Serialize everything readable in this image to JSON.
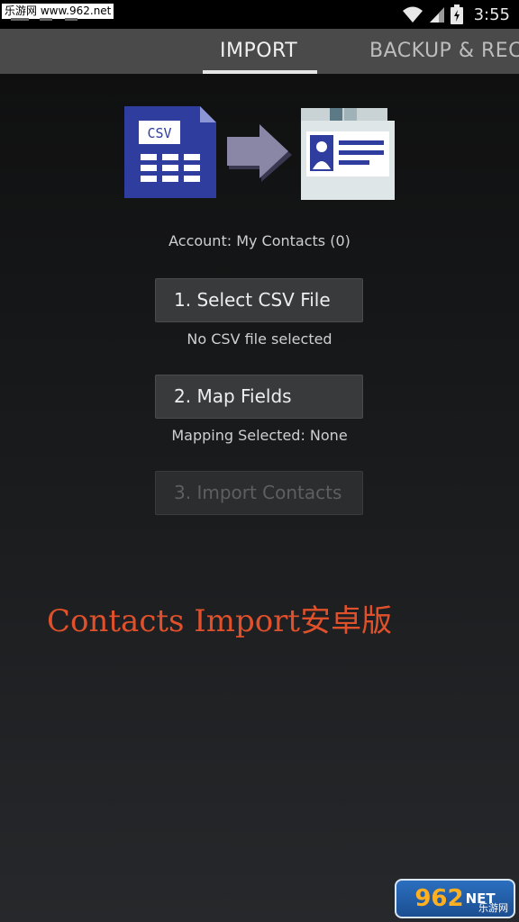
{
  "status_bar": {
    "watermark": "乐游网 www.962.net",
    "time": "3:55",
    "icons": [
      "wifi-icon",
      "signal-icon",
      "battery-icon"
    ]
  },
  "tabs": [
    {
      "label": "IMPORT",
      "active": true
    },
    {
      "label": "BACKUP & RECO",
      "active": false
    }
  ],
  "hero": {
    "file_label": "CSV",
    "icons": [
      "csv-file-icon",
      "arrow-right-icon",
      "contact-card-icon"
    ]
  },
  "account_text": "Account: My Contacts (0)",
  "steps": [
    {
      "button_label": "1. Select CSV File",
      "status": "No CSV file selected",
      "enabled": true
    },
    {
      "button_label": "2. Map Fields",
      "status": "Mapping Selected: None",
      "enabled": true
    },
    {
      "button_label": "3. Import Contacts",
      "enabled": false
    }
  ],
  "overlay_title": "Contacts Import安卓版",
  "corner_badge": {
    "number": "962",
    "net": "NET",
    "sub": "乐游网"
  },
  "colors": {
    "tab_bar": "#4a4a4a",
    "button_bg": "#393a3c",
    "overlay_title": "#e0502a",
    "csv_blue": "#2f3e9e",
    "arrow": "#8a86a6"
  }
}
